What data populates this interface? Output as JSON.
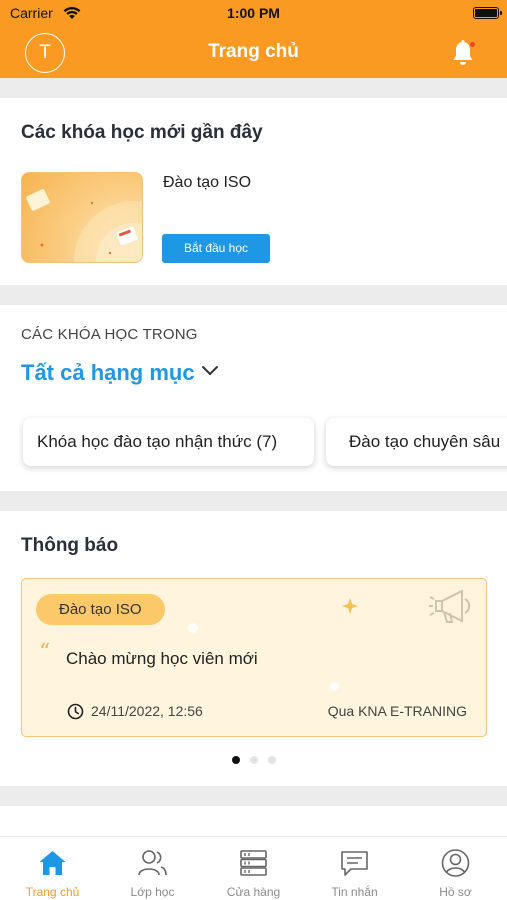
{
  "status_bar": {
    "carrier": "Carrier",
    "time": "1:00 PM"
  },
  "header": {
    "avatar_letter": "T",
    "title": "Trang chủ",
    "accent_color": "#fb9a22"
  },
  "recent_courses": {
    "title": "Các khóa học mới gần đây",
    "items": [
      {
        "name": "Đào tạo ISO",
        "button_label": "Bắt đầu học"
      }
    ]
  },
  "categories": {
    "caption": "CÁC KHÓA HỌC TRONG",
    "selected": "Tất cả hạng mục",
    "chips": [
      "Khóa học đào tạo nhận thức (7)",
      "Đào tạo chuyên sâu"
    ]
  },
  "notifications": {
    "title": "Thông báo",
    "items": [
      {
        "tag": "Đào tạo ISO",
        "message": "Chào mừng học viên mới",
        "datetime": "24/11/2022, 12:56",
        "source": "Qua KNA E-TRANING"
      }
    ],
    "page_count": 3,
    "active_page": 1
  },
  "tabbar": {
    "items": [
      {
        "label": "Trang chủ",
        "icon": "home-icon",
        "active": true
      },
      {
        "label": "Lớp học",
        "icon": "users-icon",
        "active": false
      },
      {
        "label": "Cửa hàng",
        "icon": "store-icon",
        "active": false
      },
      {
        "label": "Tin nhắn",
        "icon": "message-icon",
        "active": false
      },
      {
        "label": "Hồ sơ",
        "icon": "profile-icon",
        "active": false
      }
    ]
  },
  "colors": {
    "primary_blue": "#1e97e4",
    "accent_orange": "#fb9a22",
    "notice_bg": "#fff4dd"
  }
}
